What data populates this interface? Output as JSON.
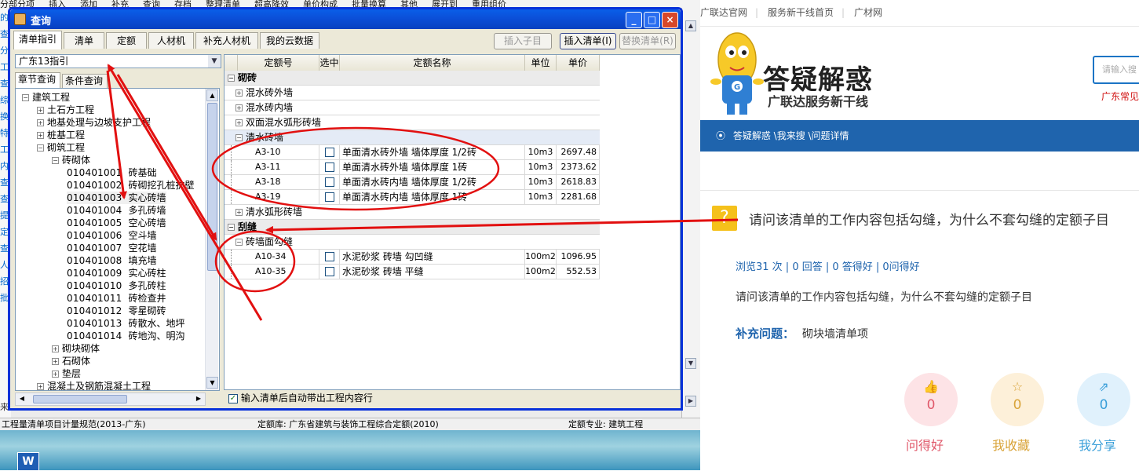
{
  "desktop": {
    "word_icon_letter": "W"
  },
  "bg_app": {
    "menu_items": [
      "分部分项",
      "插入",
      "添加",
      "补充",
      "查询",
      "存档",
      "整理清单",
      "超高降效",
      "单价构成",
      "批量换算",
      "其他",
      "展开到",
      "重用组价"
    ],
    "left_col_chars": [
      "的",
      "查",
      "分",
      "工",
      "查",
      "综",
      "换",
      "特",
      "工",
      "内",
      "查",
      "查",
      "提",
      "定",
      "查",
      "人",
      "招",
      "批"
    ],
    "status": {
      "norm": "工程量清单项目计量规范(2013-广东)",
      "quota_lib": "定额库: 广东省建筑与装饰工程综合定额(2010)",
      "quota_major": "定额专业: 建筑工程"
    },
    "bottom_left": "来"
  },
  "dialog": {
    "title": "查询",
    "controls": {
      "min": "_",
      "max": "□",
      "close": "×"
    },
    "tabs": [
      "清单指引",
      "清单",
      "定额",
      "人材机",
      "补充人材机",
      "我的云数据"
    ],
    "active_tab": "清单指引",
    "buttons": {
      "insert_child": "插入子目",
      "insert_list": "插入清单(I)",
      "replace_list": "替换清单(R)"
    },
    "combo_value": "广东13指引",
    "subtabs": [
      "章节查询",
      "条件查询"
    ],
    "tree": [
      {
        "level": 0,
        "exp": "-",
        "label": "建筑工程"
      },
      {
        "level": 1,
        "exp": "+",
        "label": "土石方工程"
      },
      {
        "level": 1,
        "exp": "+",
        "label": "地基处理与边坡支护工程"
      },
      {
        "level": 1,
        "exp": "+",
        "label": "桩基工程"
      },
      {
        "level": 1,
        "exp": "-",
        "label": "砌筑工程"
      },
      {
        "level": 2,
        "exp": "-",
        "label": "砖砌体"
      },
      {
        "level": 3,
        "code": "010401001",
        "label": "砖基础"
      },
      {
        "level": 3,
        "code": "010401002",
        "label": "砖砌挖孔桩护壁"
      },
      {
        "level": 3,
        "code": "010401003",
        "label": "实心砖墙",
        "selected": true
      },
      {
        "level": 3,
        "code": "010401004",
        "label": "多孔砖墙"
      },
      {
        "level": 3,
        "code": "010401005",
        "label": "空心砖墙"
      },
      {
        "level": 3,
        "code": "010401006",
        "label": "空斗墙"
      },
      {
        "level": 3,
        "code": "010401007",
        "label": "空花墙"
      },
      {
        "level": 3,
        "code": "010401008",
        "label": "填充墙"
      },
      {
        "level": 3,
        "code": "010401009",
        "label": "实心砖柱"
      },
      {
        "level": 3,
        "code": "010401010",
        "label": "多孔砖柱"
      },
      {
        "level": 3,
        "code": "010401011",
        "label": "砖检查井"
      },
      {
        "level": 3,
        "code": "010401012",
        "label": "零星砌砖"
      },
      {
        "level": 3,
        "code": "010401013",
        "label": "砖散水、地坪"
      },
      {
        "level": 3,
        "code": "010401014",
        "label": "砖地沟、明沟"
      },
      {
        "level": 2,
        "exp": "+",
        "label": "砌块砌体"
      },
      {
        "level": 2,
        "exp": "+",
        "label": "石砌体"
      },
      {
        "level": 2,
        "exp": "+",
        "label": "垫层"
      },
      {
        "level": 1,
        "exp": "+",
        "label": "混凝土及钢筋混凝土工程"
      }
    ],
    "grid_headers": [
      "定额号",
      "选中",
      "定额名称",
      "单位",
      "单价"
    ],
    "grid_rows": [
      {
        "type": "grp",
        "exp": "-",
        "label": "砌砖"
      },
      {
        "type": "sub",
        "exp": "+",
        "label": "混水砖外墙"
      },
      {
        "type": "sub",
        "exp": "+",
        "label": "混水砖内墙"
      },
      {
        "type": "sub",
        "exp": "+",
        "label": "双面混水弧形砖墙"
      },
      {
        "type": "sub",
        "exp": "-",
        "label": "清水砖墙",
        "hl": true
      },
      {
        "type": "item",
        "code": "A3-10",
        "name": "单面清水砖外墙 墙体厚度 1/2砖",
        "unit": "10m3",
        "price": "2697.48"
      },
      {
        "type": "item",
        "code": "A3-11",
        "name": "单面清水砖外墙 墙体厚度 1砖",
        "unit": "10m3",
        "price": "2373.62"
      },
      {
        "type": "item",
        "code": "A3-18",
        "name": "单面清水砖内墙 墙体厚度 1/2砖",
        "unit": "10m3",
        "price": "2618.83"
      },
      {
        "type": "item",
        "code": "A3-19",
        "name": "单面清水砖内墙 墙体厚度 1砖",
        "unit": "10m3",
        "price": "2281.68"
      },
      {
        "type": "sub",
        "exp": "+",
        "label": "清水弧形砖墙"
      },
      {
        "type": "grp",
        "exp": "-",
        "label": "刮缝"
      },
      {
        "type": "sub",
        "exp": "-",
        "label": "砖墙面勾缝"
      },
      {
        "type": "item",
        "code": "A10-34",
        "name": "水泥砂浆 砖墙 勾凹缝",
        "unit": "100m2",
        "price": "1096.95"
      },
      {
        "type": "item",
        "code": "A10-35",
        "name": "水泥砂浆 砖墙 平缝",
        "unit": "100m2",
        "price": "552.53"
      }
    ],
    "auto_bring_label": "输入清单后自动带出工程内容行"
  },
  "web": {
    "top_links": [
      "广联达官网",
      "服务新干线首页",
      "广材网"
    ],
    "brand_big": "答疑解惑",
    "brand_small": "广联达服务新干线",
    "search_placeholder": "请输入搜",
    "search_red": "广东常见",
    "breadcrumb": "答疑解惑 \\我来搜 \\问题详情",
    "question_title": "请问该清单的工作内容包括勾缝，为什么不套勾缝的定额子目",
    "meta": "浏览31 次 | 0 回答 | 0 答得好 | 0问得好",
    "body": "请问该清单的工作内容包括勾缝，为什么不套勾缝的定额子目",
    "extra_label": "补充问题：",
    "extra_text": "砌块墙清单项",
    "actions": [
      {
        "label": "问得好",
        "count": "0",
        "color": "#e0586a",
        "bg": "#fde3e6",
        "icon": "thumbs-up-icon"
      },
      {
        "label": "我收藏",
        "count": "0",
        "color": "#d9a43a",
        "bg": "#fdf0d9",
        "icon": "star-icon"
      },
      {
        "label": "我分享",
        "count": "0",
        "color": "#3a9fd9",
        "bg": "#e0f1fc",
        "icon": "share-icon"
      }
    ]
  },
  "colors": {
    "annotation_red": "#e21010",
    "nav_blue": "#1f64ad",
    "title_blue": "#0a5fe8"
  }
}
